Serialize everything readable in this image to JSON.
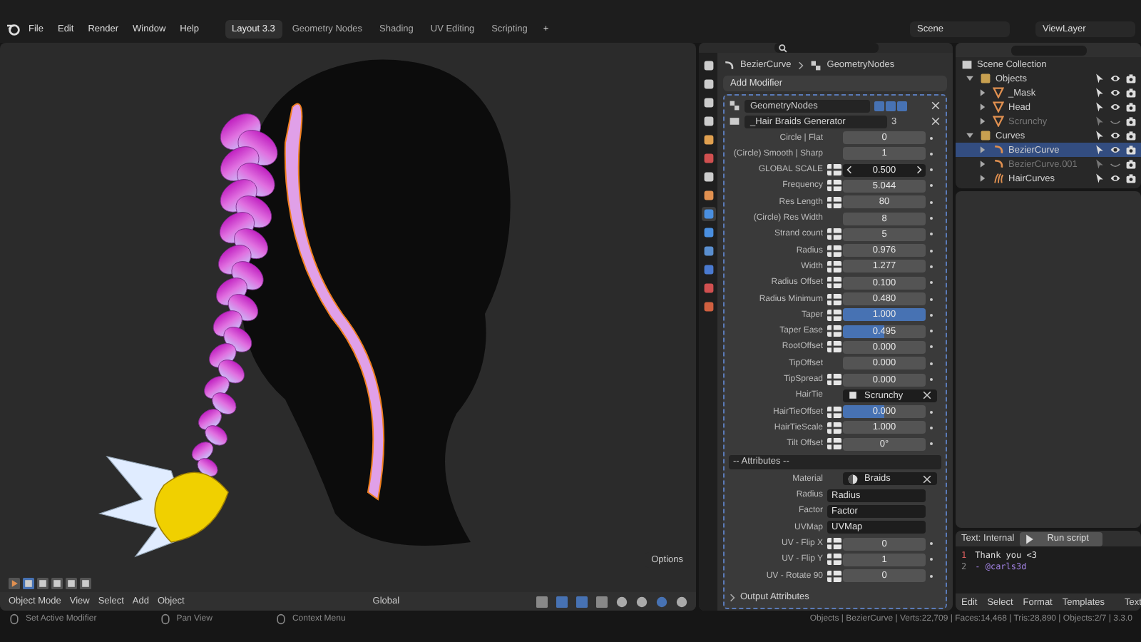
{
  "menu": [
    "File",
    "Edit",
    "Render",
    "Window",
    "Help"
  ],
  "workspaces": [
    {
      "label": "Layout 3.3",
      "selected": true
    },
    {
      "label": "Geometry Nodes",
      "selected": false
    },
    {
      "label": "Shading",
      "selected": false
    },
    {
      "label": "UV Editing",
      "selected": false
    },
    {
      "label": "Scripting",
      "selected": false
    }
  ],
  "add_workspace": "+",
  "scene": "Scene",
  "view_layer": "ViewLayer",
  "viewport": {
    "options": "Options",
    "mode": "Object Mode",
    "menus": [
      "View",
      "Select",
      "Add",
      "Object"
    ],
    "orientation": "Global"
  },
  "properties": {
    "tabs": [
      {
        "selected": false
      },
      {
        "selected": false
      },
      {
        "selected": false
      },
      {
        "selected": false
      },
      {
        "selected": false
      },
      {
        "selected": false
      },
      {
        "selected": false
      },
      {
        "selected": false
      },
      {
        "selected": true
      },
      {
        "selected": false
      },
      {
        "selected": false
      },
      {
        "selected": false
      },
      {
        "selected": false
      },
      {
        "selected": false
      }
    ],
    "breadcrumb": [
      "BezierCurve",
      "GeometryNodes"
    ],
    "add_modifier": "Add Modifier",
    "modifier": {
      "name": "GeometryNodes",
      "node_group": "_Hair Braids Generator",
      "users": "3",
      "inputs": [
        {
          "label": "Circle | Flat",
          "kind": "number",
          "value": "0",
          "socket": false
        },
        {
          "label": "(Circle) Smooth | Sharp",
          "kind": "number",
          "value": "1",
          "socket": false
        },
        {
          "label": "GLOBAL SCALE",
          "kind": "stepper",
          "value": "0.500",
          "socket": true
        },
        {
          "label": "Frequency",
          "kind": "number",
          "value": "5.044",
          "socket": true
        },
        {
          "label": "Res Length",
          "kind": "number",
          "value": "80",
          "socket": true
        },
        {
          "label": "(Circle) Res Width",
          "kind": "number",
          "value": "8",
          "socket": false
        },
        {
          "label": "Strand count",
          "kind": "number",
          "value": "5",
          "socket": true
        },
        {
          "label": "Radius",
          "kind": "number",
          "value": "0.976",
          "socket": true
        },
        {
          "label": "Width",
          "kind": "number",
          "value": "1.277",
          "socket": true
        },
        {
          "label": "Radius Offset",
          "kind": "number",
          "value": "0.100",
          "socket": true
        },
        {
          "label": "Radius Minimum",
          "kind": "number",
          "value": "0.480",
          "socket": true
        },
        {
          "label": "Taper",
          "kind": "slider",
          "value": "1.000",
          "level": 1,
          "socket": true
        },
        {
          "label": "Taper Ease",
          "kind": "slider",
          "value": "0.495",
          "level": 0.495,
          "socket": true
        },
        {
          "label": "RootOffset",
          "kind": "number",
          "value": "0.000",
          "socket": true
        },
        {
          "label": "TipOffset",
          "kind": "number",
          "value": "0.000",
          "socket": false
        },
        {
          "label": "TipSpread",
          "kind": "number",
          "value": "0.000",
          "socket": true
        },
        {
          "label": "HairTie",
          "kind": "object",
          "value": "Scrunchy",
          "socket": false
        },
        {
          "label": "HairTieOffset",
          "kind": "slider",
          "value": "0.000",
          "level": 0.5,
          "socket": true
        },
        {
          "label": "HairTieScale",
          "kind": "number",
          "value": "1.000",
          "socket": true
        },
        {
          "label": "Tilt Offset",
          "kind": "number",
          "value": "0°",
          "socket": true
        },
        {
          "label": "-- Attributes --",
          "kind": "section"
        },
        {
          "label": "Material",
          "kind": "material",
          "value": "Braids",
          "socket": false
        },
        {
          "label": "Radius",
          "kind": "text",
          "value": "Radius",
          "socket": false
        },
        {
          "label": "Factor",
          "kind": "text",
          "value": "Factor",
          "socket": false
        },
        {
          "label": "UVMap",
          "kind": "text",
          "value": "UVMap",
          "socket": false
        },
        {
          "label": "UV - Flip X",
          "kind": "number",
          "value": "0",
          "socket": true
        },
        {
          "label": "UV - Flip Y",
          "kind": "number",
          "value": "1",
          "socket": true
        },
        {
          "label": "UV - Rotate 90",
          "kind": "number",
          "value": "0",
          "socket": true
        }
      ],
      "output_attributes": "Output Attributes"
    }
  },
  "outliner": {
    "root": "Scene Collection",
    "items": [
      {
        "label": "Objects",
        "kind": "collection",
        "selected": false,
        "hidden": false,
        "children": [
          {
            "label": "_Mask",
            "kind": "mesh",
            "selected": false,
            "hidden": false
          },
          {
            "label": "Head",
            "kind": "mesh",
            "selected": false,
            "hidden": false
          },
          {
            "label": "Scrunchy",
            "kind": "mesh",
            "selected": false,
            "hidden": true
          }
        ]
      },
      {
        "label": "Curves",
        "kind": "collection",
        "selected": false,
        "hidden": false,
        "children": [
          {
            "label": "BezierCurve",
            "kind": "curve",
            "selected": true,
            "hidden": false
          },
          {
            "label": "BezierCurve.001",
            "kind": "curve",
            "selected": false,
            "hidden": true
          },
          {
            "label": "HairCurves",
            "kind": "hair",
            "selected": false,
            "hidden": false
          }
        ]
      }
    ]
  },
  "text_editor": {
    "title": "Text: Internal",
    "run": "Run script",
    "lines": [
      {
        "number": "1",
        "text": "Thank you <3",
        "current": true
      },
      {
        "number": "2",
        "text": "- @carls3d",
        "current": false
      }
    ],
    "menus": [
      "Edit",
      "Select",
      "Format",
      "Templates"
    ],
    "text_menu": "Text"
  },
  "status": {
    "hints": [
      "Set Active Modifier",
      "Pan View",
      "Context Menu"
    ],
    "stats": "Objects | BezierCurve | Verts:22,709 | Faces:14,468 | Tris:28,890 | Objects:2/7 | 3.3.0"
  }
}
